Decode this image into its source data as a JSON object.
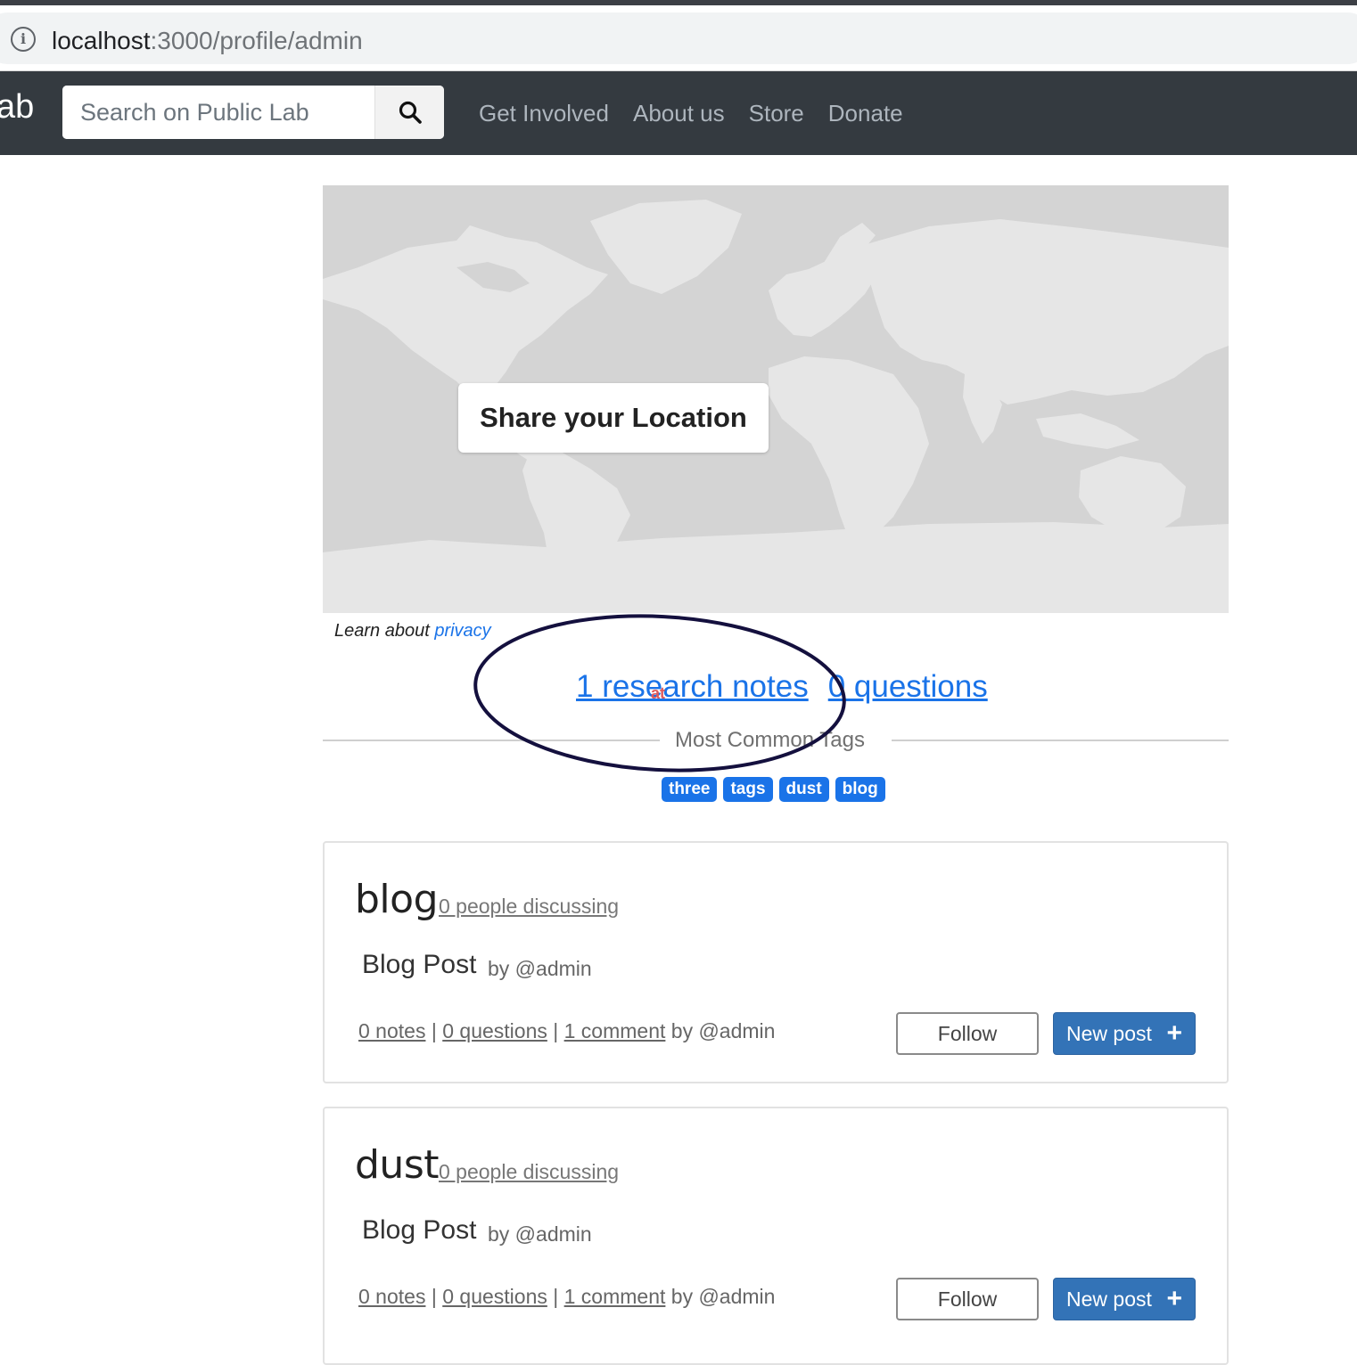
{
  "browser": {
    "url_host": "localhost",
    "url_path": ":3000/profile/admin"
  },
  "navbar": {
    "brand_fragment": "ab",
    "search_placeholder": "Search on Public Lab",
    "links": [
      "Get Involved",
      "About us",
      "Store",
      "Donate"
    ]
  },
  "map": {
    "share_button": "Share your Location",
    "privacy_prefix": "Learn about",
    "privacy_link": "privacy"
  },
  "counts": {
    "notes": "1 research notes",
    "questions": "0 questions",
    "marker": "at"
  },
  "tags_section": {
    "title": "Most Common Tags",
    "tags": [
      "three",
      "tags",
      "dust",
      "blog"
    ]
  },
  "cards": [
    {
      "title": "blog",
      "discussing": "0 people discussing",
      "post_title": "Blog Post",
      "post_by": "by @admin",
      "notes": "0 notes",
      "questions": "0 questions",
      "comment": "1 comment",
      "comment_by": "by @admin",
      "follow": "Follow",
      "new_post": "New post"
    },
    {
      "title": "dust",
      "discussing": "0 people discussing",
      "post_title": "Blog Post",
      "post_by": "by @admin",
      "notes": "0 notes",
      "questions": "0 questions",
      "comment": "1 comment",
      "comment_by": "by @admin",
      "follow": "Follow",
      "new_post": "New post"
    }
  ],
  "colors": {
    "navbar": "#343a40",
    "link_blue": "#1a73e8",
    "primary_button": "#3373b7",
    "annotation_oval": "#14103e"
  },
  "icons": [
    "info-icon",
    "search-icon",
    "plus-icon"
  ]
}
